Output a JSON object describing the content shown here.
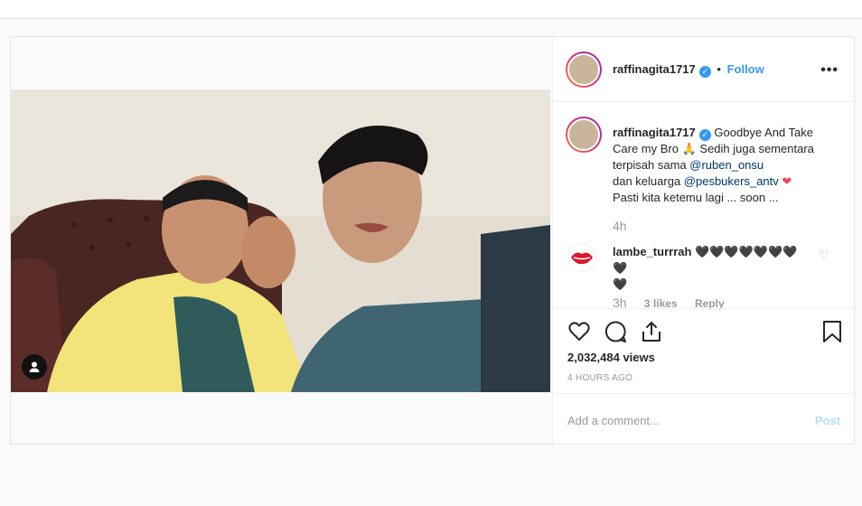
{
  "post": {
    "username": "raffinagita1717",
    "follow_label": "Follow",
    "separator": "•",
    "more_label": "•••",
    "caption": {
      "part1": "Goodbye And Take Care my Bro",
      "emoji_pray": "🙏",
      "part2": "Sedih juga sementara terpisah sama",
      "mention1": "@ruben_onsu",
      "part3": "dan keluarga",
      "mention2": "@pesbukers_antv",
      "emoji_heart": "❤",
      "part4": "Pasti kita ketemu lagi ... soon ..."
    },
    "caption_time": "4h",
    "comment": {
      "username": "lambe_turrrah",
      "text": "🖤🖤🖤🖤🖤🖤🖤🖤",
      "text2": "🖤",
      "time": "3h",
      "likes": "3 likes",
      "reply": "Reply"
    },
    "views": "2,032,484 views",
    "time_ago": "4 HOURS AGO",
    "add_comment_placeholder": "Add a comment...",
    "post_label": "Post"
  }
}
